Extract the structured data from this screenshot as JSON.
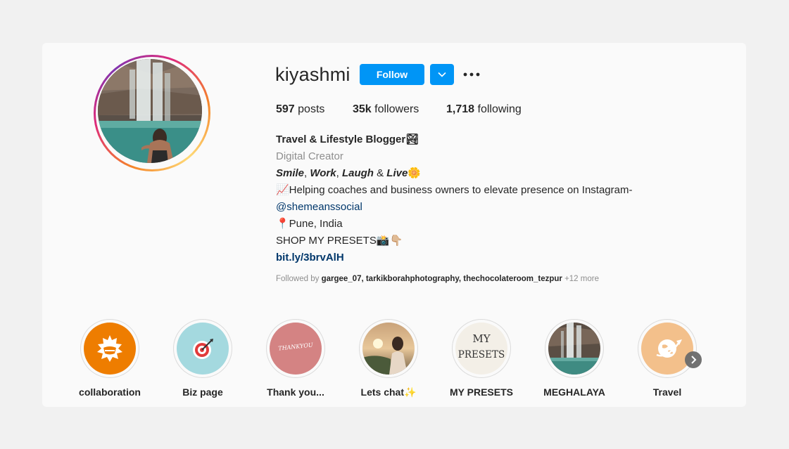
{
  "profile": {
    "username": "kiyashmi",
    "follow_label": "Follow",
    "stats": {
      "posts_count": "597",
      "posts_label": "posts",
      "followers_count": "35k",
      "followers_label": "followers",
      "following_count": "1,718",
      "following_label": "following"
    },
    "bio": {
      "name": "Travel & Lifestyle Blogger🏞",
      "category": "Digital Creator",
      "tagline_smile": "Smile",
      "tagline_work": "Work",
      "tagline_laugh": "Laugh",
      "tagline_live": "Live",
      "tagline_sep1": ", ",
      "tagline_sep2": ", ",
      "tagline_sep3": " & ",
      "tagline_emoji": "🌼",
      "line_helping": "📈Helping coaches and business owners to elevate presence on Instagram-",
      "mention": "@shemeanssocial",
      "location": "📍Pune, India",
      "shop": "SHOP MY PRESETS📸👇🏼",
      "link": "bit.ly/3brvAlH"
    },
    "followed_by": {
      "prefix": "Followed by ",
      "users": "gargee_07, tarkikborahphotography, thechocolateroom_tezpur",
      "more": " +12 more"
    }
  },
  "highlights": [
    {
      "label": "collaboration",
      "icon": "handshake-icon",
      "bg": "#ee7d00"
    },
    {
      "label": "Biz page",
      "icon": "target-icon",
      "bg": "#a4d9df"
    },
    {
      "label": "Thank you...",
      "icon": "thankyou-text",
      "bg": "#d48383",
      "inner_text": "THANKYOU"
    },
    {
      "label": "Lets chat✨",
      "icon": "portrait-photo",
      "bg": "#9c7a55"
    },
    {
      "label": "MY PRESETS",
      "icon": "presets-text",
      "bg": "#f3efe7",
      "inner_line1": "MY",
      "inner_line2": "PRESETS"
    },
    {
      "label": "MEGHALAYA",
      "icon": "waterfall-photo",
      "bg": "#4a7a74"
    },
    {
      "label": "Travel",
      "icon": "plane-globe-icon",
      "bg": "#f3c08b"
    }
  ],
  "colors": {
    "accent": "#0095f6",
    "link": "#00376b",
    "muted": "#8e8e8e"
  }
}
